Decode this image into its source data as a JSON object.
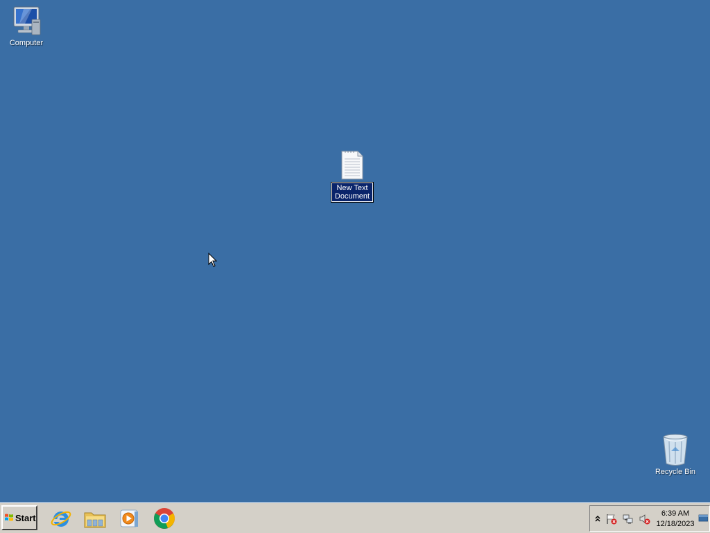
{
  "desktop": {
    "background_color": "#3a6ea5",
    "icons": {
      "computer": {
        "label": "Computer",
        "icon": "computer-icon"
      },
      "new_text_document": {
        "label": "New Text Document",
        "icon": "text-document-icon",
        "state": "renaming"
      },
      "recycle_bin": {
        "label": "Recycle Bin",
        "icon": "recycle-bin-icon"
      }
    }
  },
  "taskbar": {
    "start_label": "Start",
    "pinned": [
      {
        "name": "Internet Explorer",
        "icon": "internet-explorer-icon"
      },
      {
        "name": "Windows Explorer",
        "icon": "file-explorer-icon"
      },
      {
        "name": "Windows Media Player",
        "icon": "media-player-icon"
      },
      {
        "name": "Google Chrome",
        "icon": "chrome-icon"
      }
    ],
    "tray": {
      "icons": [
        "show-hidden-icons-chevron",
        "action-center-flag-icon",
        "network-icon",
        "volume-muted-icon"
      ],
      "time": "6:39 AM",
      "date": "12/18/2023"
    }
  }
}
